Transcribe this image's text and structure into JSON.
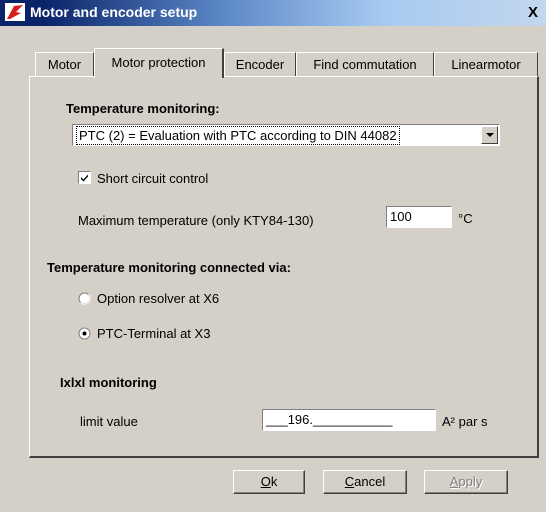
{
  "window": {
    "title": "Motor and encoder setup",
    "close_glyph": "X",
    "title_gradient_start": "#0a246a",
    "face_color": "#d4d0c8"
  },
  "tabs": [
    {
      "label": "Motor",
      "active": false
    },
    {
      "label": "Motor protection",
      "active": true
    },
    {
      "label": "Encoder",
      "active": false
    },
    {
      "label": "Find commutation",
      "active": false
    },
    {
      "label": "Linearmotor",
      "active": false
    }
  ],
  "temperature_monitoring": {
    "heading": "Temperature monitoring:",
    "selected": "PTC (2) = Evaluation with PTC according to DIN 44082",
    "short_circuit_label": "Short circuit control",
    "short_circuit_checked": true,
    "max_temp_label": "Maximum temperature (only KTY84-130)",
    "max_temp_value": "100",
    "max_temp_unit": "°C"
  },
  "connection": {
    "heading": "Temperature monitoring connected via:",
    "options": [
      {
        "label": "Option resolver at X6",
        "selected": false
      },
      {
        "label": "PTC-Terminal at X3",
        "selected": true
      }
    ]
  },
  "ixixt": {
    "heading": "Ixlxl monitoring",
    "limit_label": "limit value",
    "limit_value": "___196.___________",
    "limit_unit": "A² par s"
  },
  "buttons": {
    "ok": {
      "accel": "O",
      "rest": "k"
    },
    "cancel": {
      "accel": "C",
      "rest": "ancel"
    },
    "apply": {
      "accel": "A",
      "rest": "pply",
      "disabled": true
    }
  }
}
